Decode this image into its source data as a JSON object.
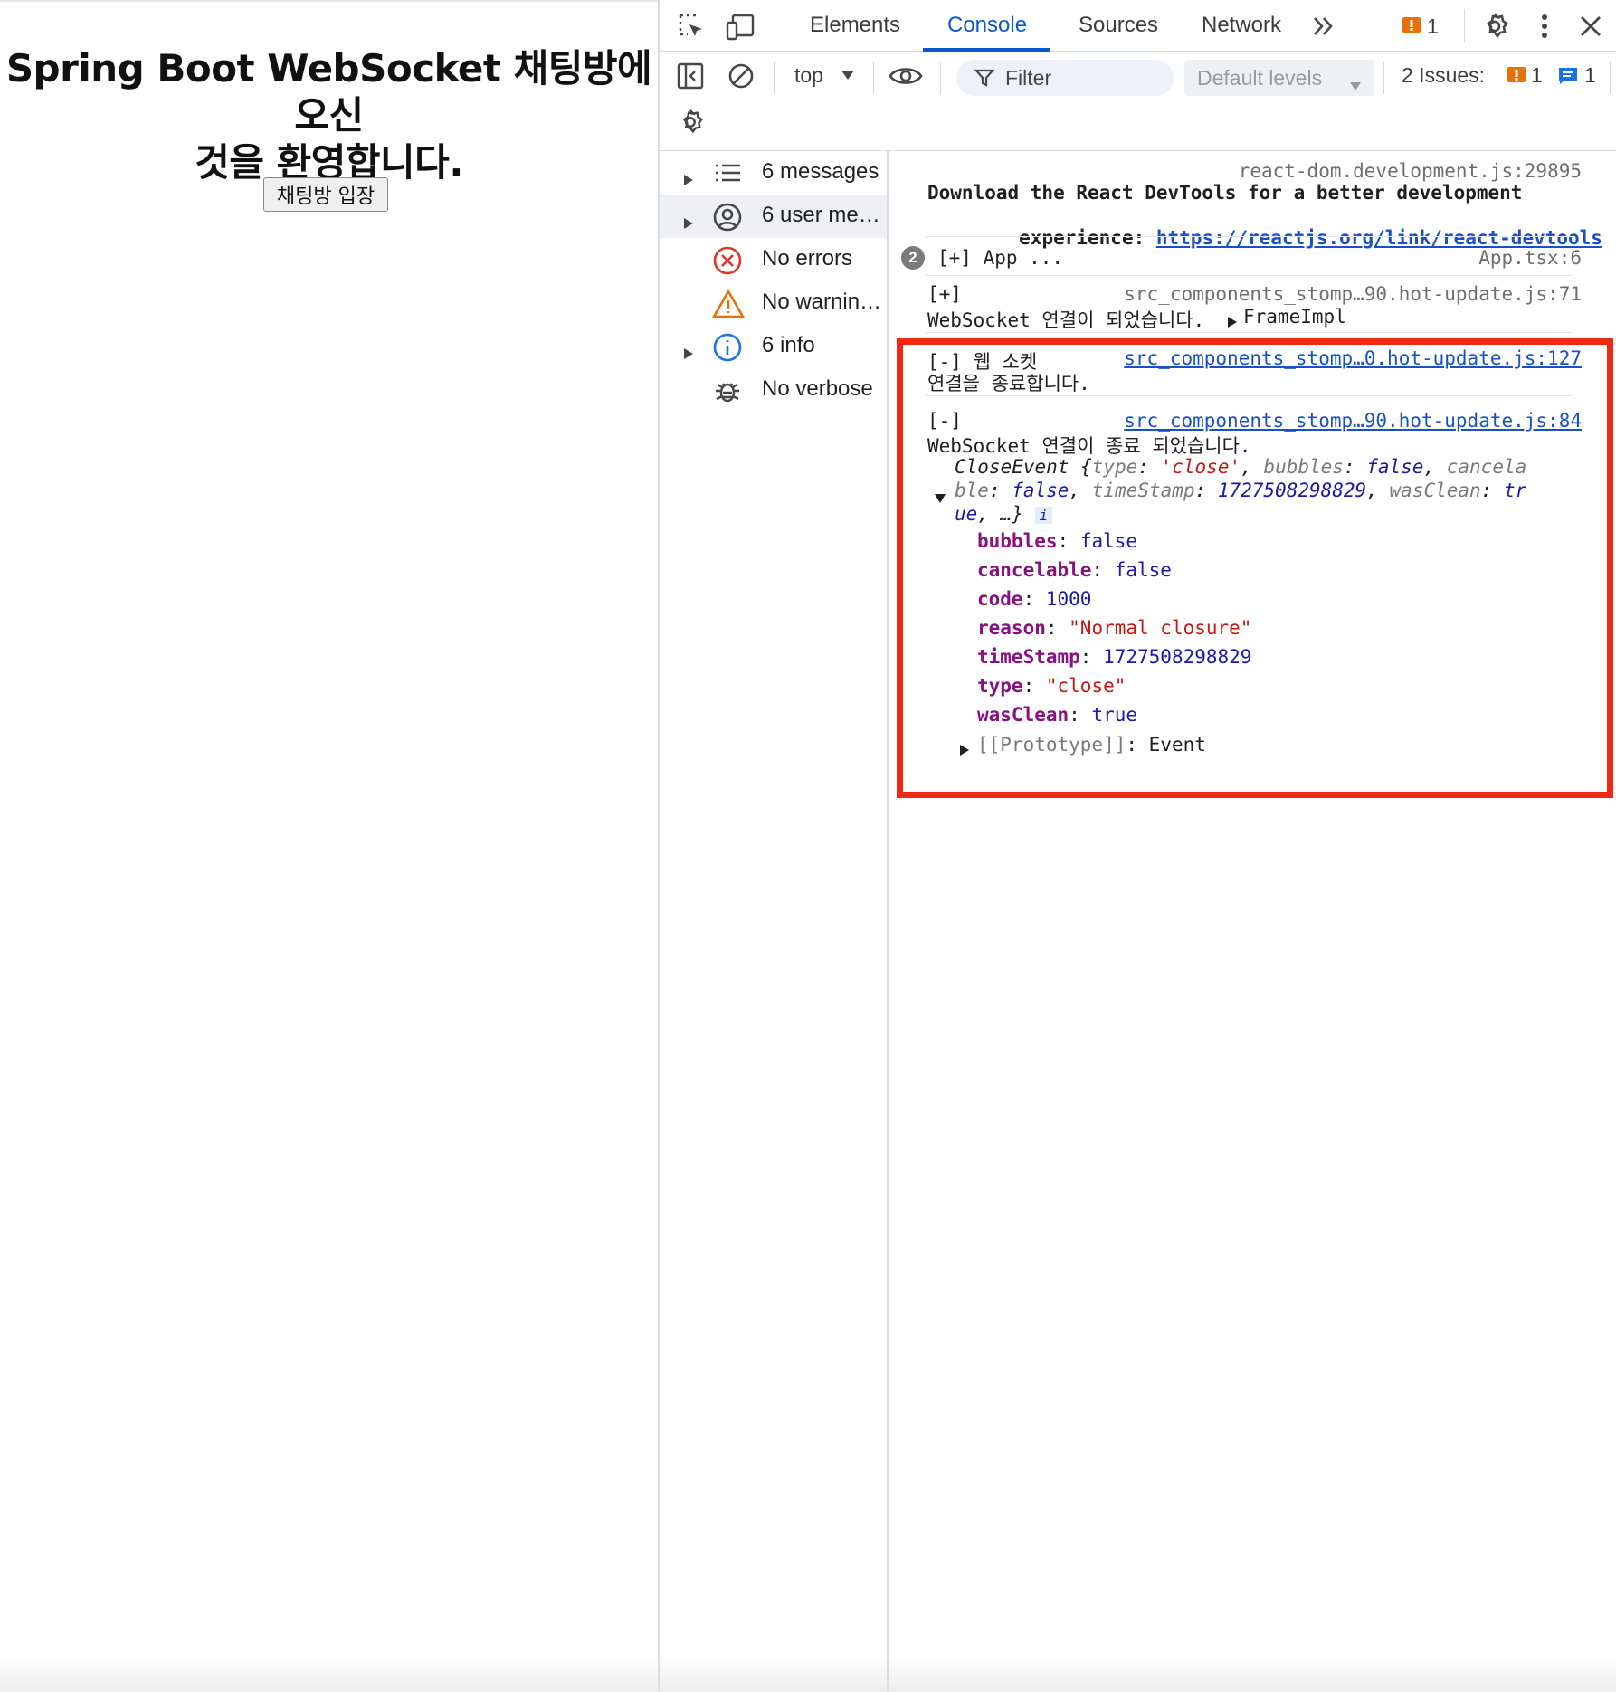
{
  "page": {
    "title_line1": "Spring Boot WebSocket 채팅방에 오신",
    "title_line2": "것을 환영합니다.",
    "enter_button": "채팅방 입장"
  },
  "devtools": {
    "tabs": [
      "Elements",
      "Console",
      "Sources",
      "Network"
    ],
    "active_tab": "Console",
    "more_tabs_icon": "chevron-double-right-icon",
    "warning_count": "1",
    "toolbar": {
      "context": "top",
      "filter_placeholder": "Filter",
      "levels": "Default levels",
      "issues_label": "2 Issues:",
      "issues_warning": "1",
      "issues_info": "1"
    },
    "sidebar": [
      {
        "label": "6 messages",
        "icon": "list-icon",
        "expandable": true
      },
      {
        "label": "6 user me…",
        "icon": "user-circle-icon",
        "expandable": true
      },
      {
        "label": "No errors",
        "icon": "error-circle-icon",
        "expandable": false
      },
      {
        "label": "No warnin…",
        "icon": "warning-triangle-icon",
        "expandable": false
      },
      {
        "label": "6 info",
        "icon": "info-circle-icon",
        "expandable": true
      },
      {
        "label": "No verbose",
        "icon": "bug-icon",
        "expandable": false
      }
    ],
    "console": {
      "m1_source": "react-dom.development.js:29895",
      "m1_text_a": "Download the React DevTools for a better development",
      "m1_text_b": "experience: ",
      "m1_link": "https://reactjs.org/link/react-devtools",
      "m2_count": "2",
      "m2_text": "[+] App ...",
      "m2_source": "App.tsx:6",
      "m3_prefix": "[+]",
      "m3_source": "src_components_stomp…90.hot-update.js:71",
      "m3_text": "WebSocket 연결이 되었습니다.",
      "m3_obj": "FrameImpl",
      "m4_prefix": "[-] 웹 소켓",
      "m4_source": "src_components_stomp…0.hot-update.js:127",
      "m4_text": "연결을 종료합니다.",
      "m5_prefix": "[-]",
      "m5_source": "src_components_stomp…90.hot-update.js:84",
      "m5_text": "WebSocket 연결이 종료 되었습니다.",
      "event": {
        "class_name": "CloseEvent",
        "preview": {
          "type_key": "type",
          "type_val": "'close'",
          "bubbles_key": "bubbles",
          "bubbles_val": "false",
          "cancela": "cancela",
          "ble": "ble",
          "cancelable_val": "false",
          "ts_key": "timeStamp",
          "ts_val": "1727508298829",
          "wc_key": "wasClean",
          "wc_val_a": "tr",
          "wc_val_b": "ue",
          "tail": ", …}",
          "badge": "i"
        },
        "props": [
          {
            "key": "bubbles",
            "value": "false",
            "kind": "bool"
          },
          {
            "key": "cancelable",
            "value": "false",
            "kind": "bool"
          },
          {
            "key": "code",
            "value": "1000",
            "kind": "num"
          },
          {
            "key": "reason",
            "value": "\"Normal closure\"",
            "kind": "str"
          },
          {
            "key": "timeStamp",
            "value": "1727508298829",
            "kind": "num"
          },
          {
            "key": "type",
            "value": "\"close\"",
            "kind": "str"
          },
          {
            "key": "wasClean",
            "value": "true",
            "kind": "bool"
          }
        ],
        "prototype_key": "[[Prototype]]",
        "prototype_val": "Event"
      }
    }
  },
  "colors": {
    "accent": "#0b57d0",
    "highlight_border": "#f02814",
    "warning": "#e8710a"
  }
}
